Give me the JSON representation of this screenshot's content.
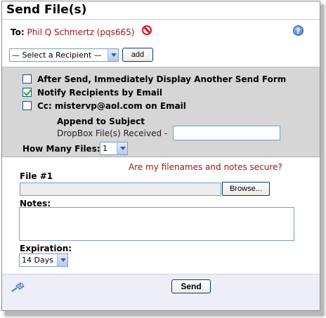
{
  "title": "Send File(s)",
  "to": {
    "label": "To:",
    "recipient": "Phil Q Schmertz (pqs665)"
  },
  "recipient_select": {
    "selected": "— Select a Recipient —"
  },
  "add_button": "add",
  "options": [
    {
      "label": "After Send, Immediately Display Another Send Form",
      "checked": false
    },
    {
      "label": "Notify Recipients by Email",
      "checked": true
    },
    {
      "label": "Cc: mistervp@aol.com on Email",
      "checked": false
    }
  ],
  "append_subject": {
    "heading": "Append to Subject",
    "label": "DropBox File(s) Received -",
    "value": ""
  },
  "how_many": {
    "label": "How Many Files:",
    "selected": "1"
  },
  "secure_link": "Are my filenames and notes secure?",
  "file": {
    "label": "File #1",
    "browse": "Browse..."
  },
  "notes": {
    "label": "Notes:",
    "value": ""
  },
  "expiration": {
    "label": "Expiration:",
    "selected": "14 Days"
  },
  "send_button": "Send",
  "colors": {
    "link_red": "#a31515",
    "band_gray": "#d6d6d6",
    "footer": "#eeeef9"
  }
}
